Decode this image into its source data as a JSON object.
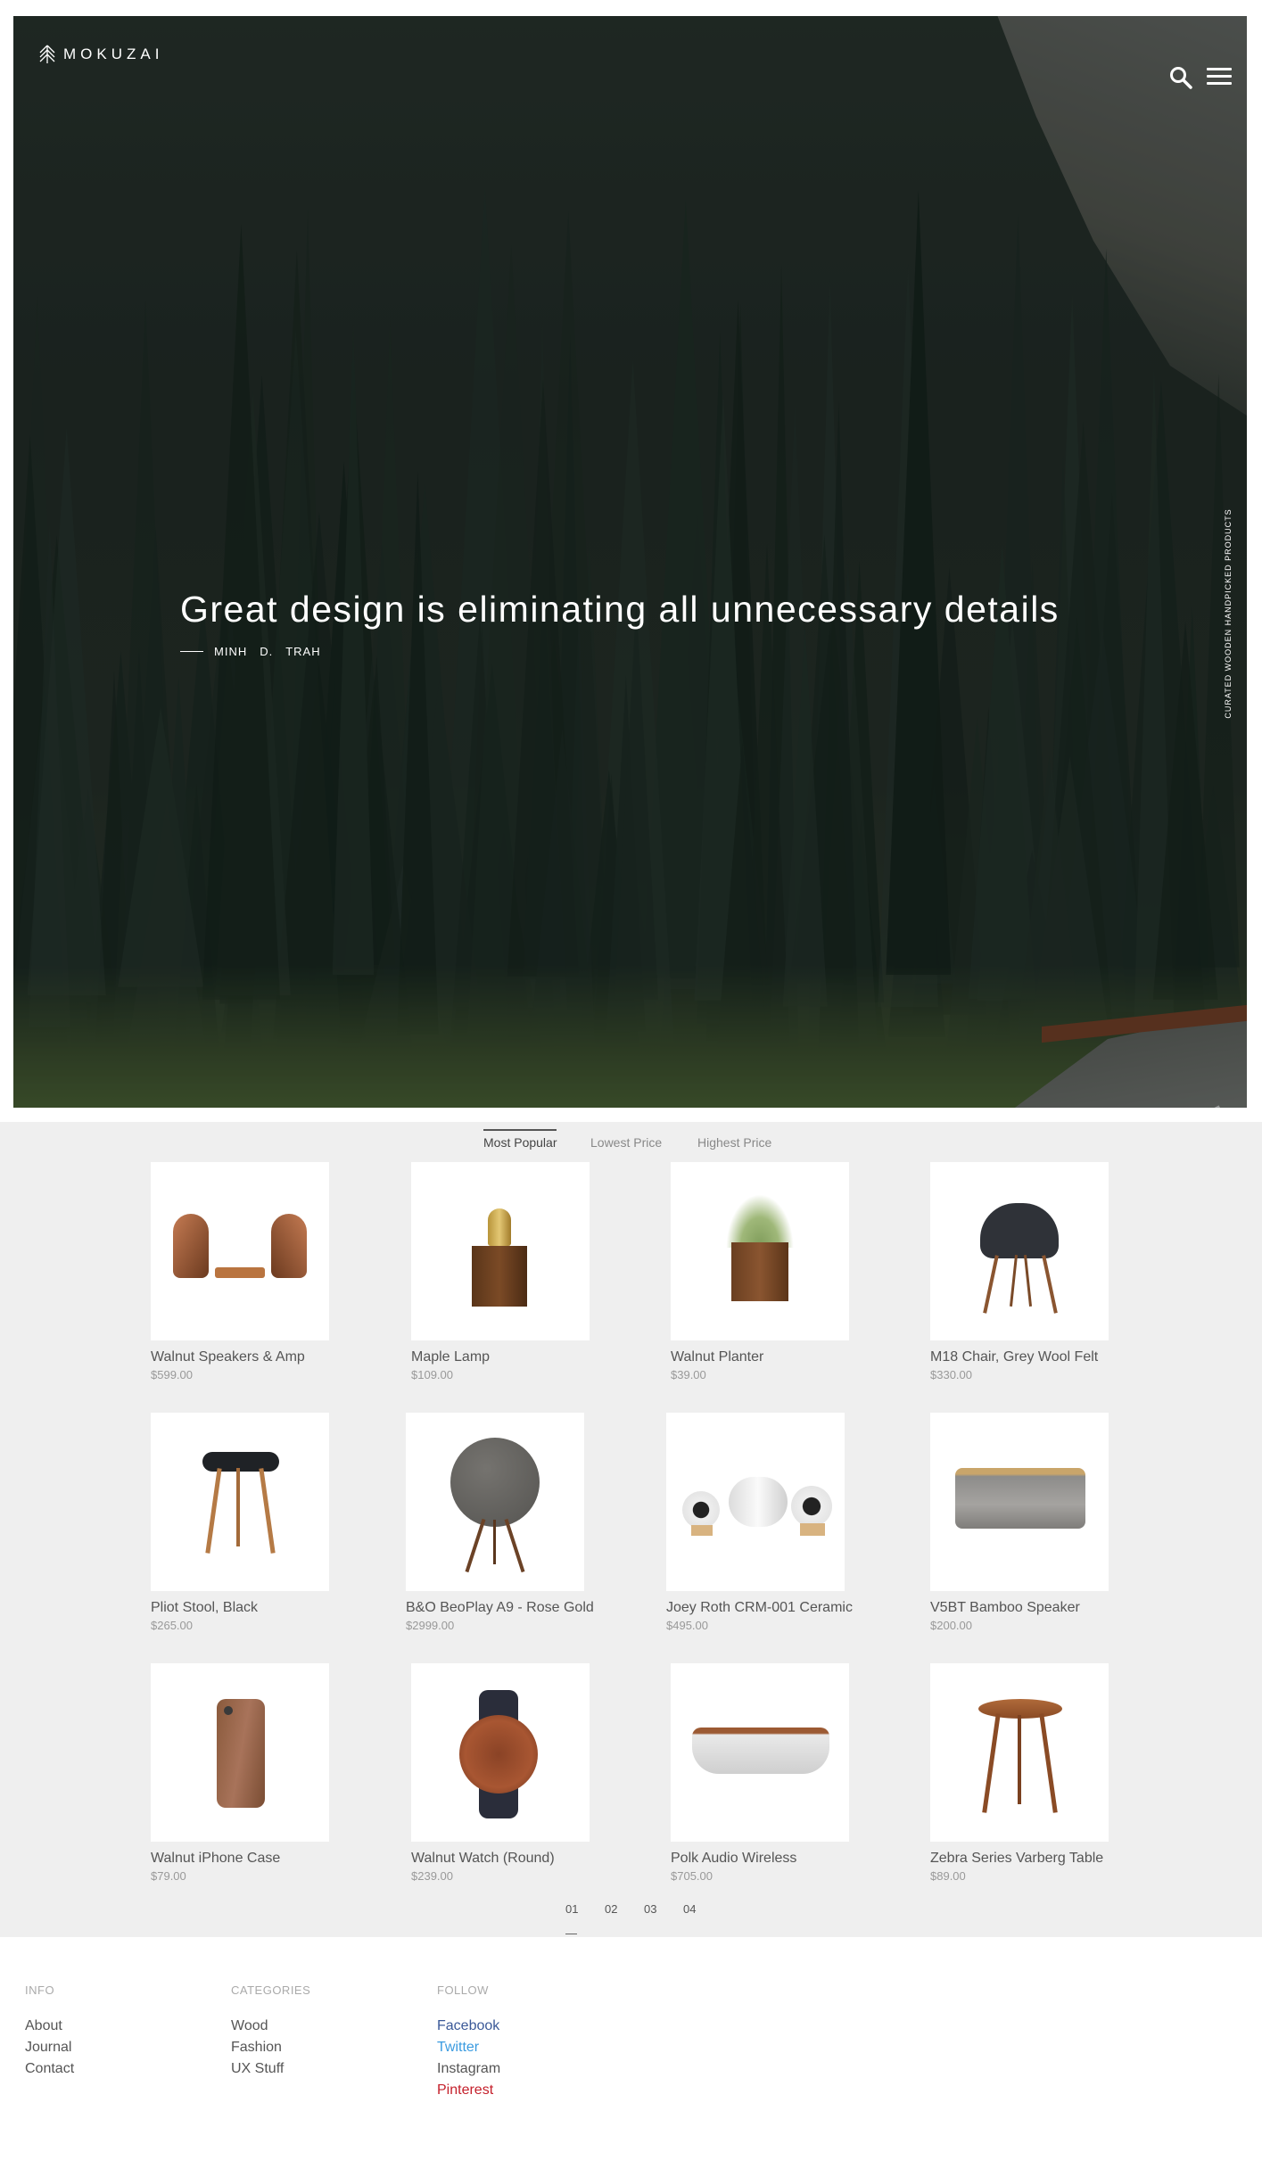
{
  "header": {
    "logo_text": "MOKUZAI",
    "icons": [
      "search-icon",
      "menu-icon"
    ]
  },
  "hero": {
    "quote": "Great design is eliminating all unnecessary details",
    "author_words": [
      "MINH",
      "D.",
      "TRAH"
    ],
    "side_text": "CURATED WOODEN HANDPICKED PRODUCTS"
  },
  "sort": {
    "tabs": [
      "Most Popular",
      "Lowest Price",
      "Highest Price"
    ],
    "active": "Most Popular"
  },
  "products": [
    {
      "name": "Walnut Speakers & Amp",
      "price": "$599.00"
    },
    {
      "name": "Maple Lamp",
      "price": "$109.00"
    },
    {
      "name": "Walnut Planter",
      "price": "$39.00"
    },
    {
      "name": "M18 Chair, Grey Wool Felt",
      "price": "$330.00"
    },
    {
      "name": "Pliot Stool, Black",
      "price": "$265.00"
    },
    {
      "name": "B&O BeoPlay A9 - Rose Gold",
      "price": "$2999.00"
    },
    {
      "name": "Joey Roth CRM-001 Ceramic",
      "price": "$495.00"
    },
    {
      "name": "V5BT Bamboo Speaker",
      "price": "$200.00"
    },
    {
      "name": "Walnut iPhone Case",
      "price": "$79.00"
    },
    {
      "name": "Walnut Watch (Round)",
      "price": "$239.00"
    },
    {
      "name": "Polk Audio Wireless",
      "price": "$705.00"
    },
    {
      "name": "Zebra Series Varberg Table",
      "price": "$89.00"
    }
  ],
  "pagination": {
    "pages": [
      "01",
      "02",
      "03",
      "04"
    ],
    "current": "01"
  },
  "footer": {
    "info": {
      "heading": "INFO",
      "links": [
        "About",
        "Journal",
        "Contact"
      ]
    },
    "categories": {
      "heading": "CATEGORIES",
      "links": [
        "Wood",
        "Fashion",
        "UX Stuff"
      ]
    },
    "follow": {
      "heading": "FOLLOW",
      "links": [
        "Facebook",
        "Twitter",
        "Instagram",
        "Pinterest"
      ]
    },
    "follow_colors": {
      "Facebook": "#3b5998",
      "Twitter": "#3a9be0",
      "Instagram": "#555555",
      "Pinterest": "#c4202b"
    }
  },
  "colors": {
    "hero_bg": "#232c27",
    "products_bg": "#efefef",
    "text": "#555555"
  }
}
